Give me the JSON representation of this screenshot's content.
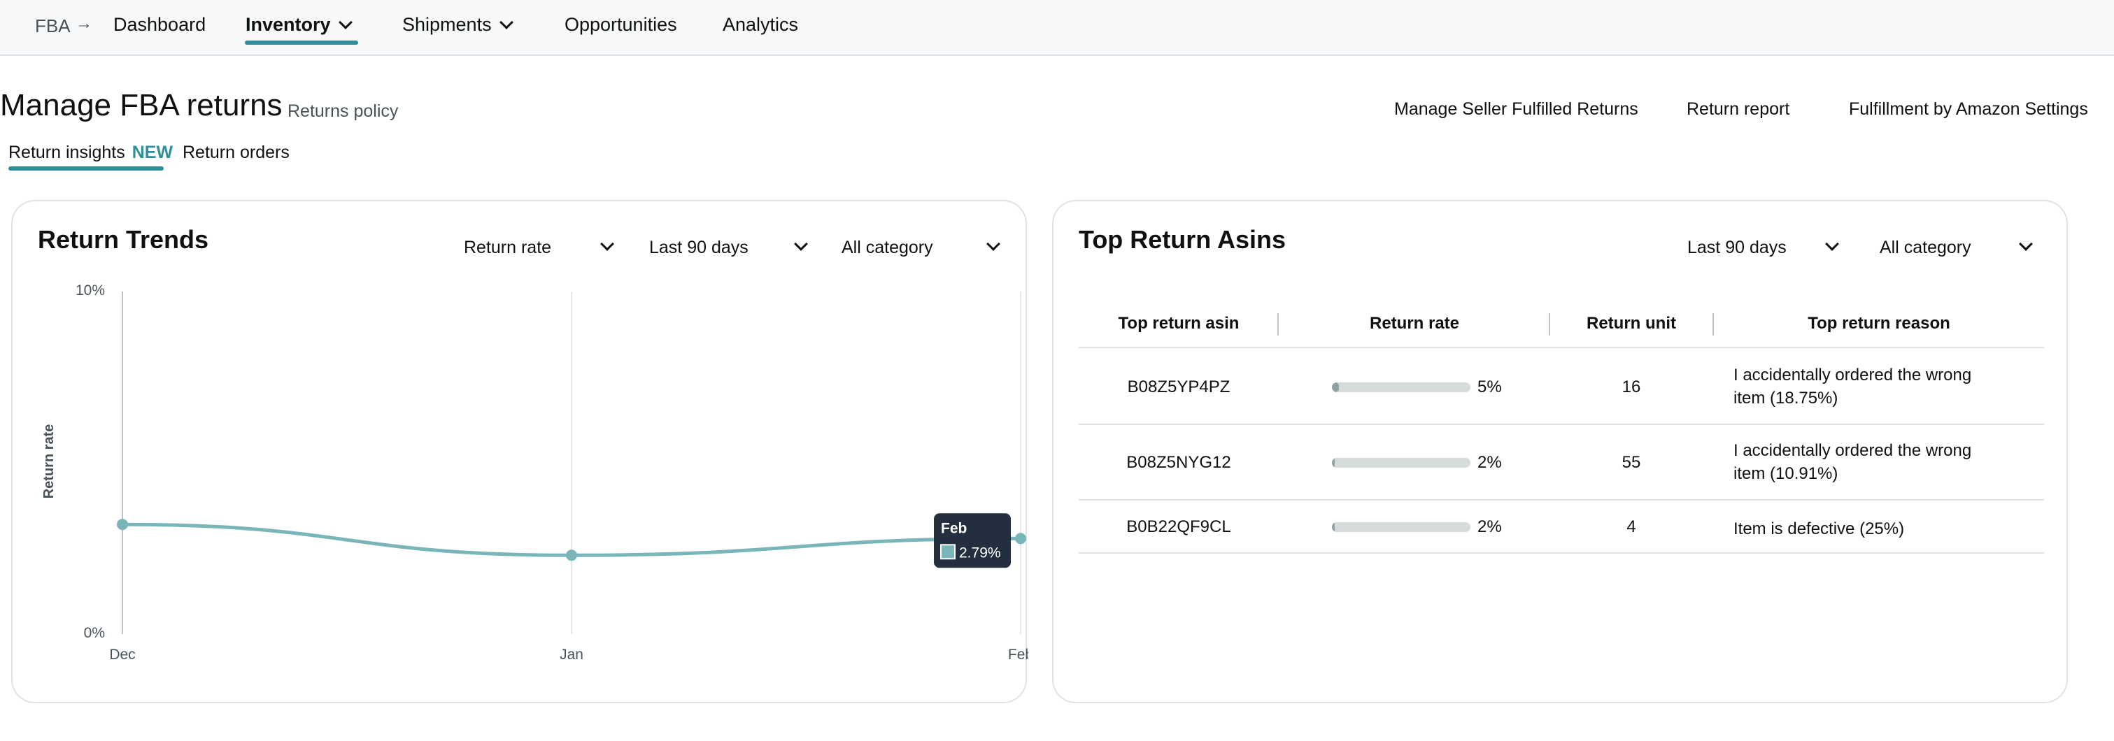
{
  "nav": {
    "breadcrumb": "FBA",
    "items": [
      {
        "label": "Dashboard"
      },
      {
        "label": "Inventory"
      },
      {
        "label": "Shipments"
      },
      {
        "label": "Opportunities"
      },
      {
        "label": "Analytics"
      }
    ]
  },
  "page": {
    "title": "Manage FBA returns",
    "policy_link": "Returns policy",
    "links": [
      "Manage Seller Fulfilled Returns",
      "Return report",
      "Fulfillment by Amazon Settings"
    ],
    "tabs": [
      {
        "label": "Return insights",
        "badge": "NEW"
      },
      {
        "label": "Return orders"
      }
    ]
  },
  "trends": {
    "title": "Return Trends",
    "filters": [
      "Return rate",
      "Last 90 days",
      "All category"
    ],
    "tooltip": {
      "label": "Feb",
      "value": "2.79%"
    }
  },
  "chart_data": {
    "type": "line",
    "categories": [
      "Dec",
      "Jan",
      "Feb"
    ],
    "values": [
      3.2,
      2.3,
      2.79
    ],
    "ylabel": "Return rate",
    "ylim": [
      0,
      10
    ],
    "ytick_labels": [
      "10%",
      "0%"
    ],
    "grid": true,
    "color": "#7ab6b9"
  },
  "asins": {
    "title": "Top Return Asins",
    "filters": [
      "Last 90 days",
      "All category"
    ],
    "columns": [
      "Top return asin",
      "Return rate",
      "Return unit",
      "Top return reason"
    ],
    "rows": [
      {
        "asin": "B08Z5YP4PZ",
        "rate": "5%",
        "rate_value": 5,
        "units": "16",
        "reason": "I accidentally ordered the wrong item (18.75%)"
      },
      {
        "asin": "B08Z5NYG12",
        "rate": "2%",
        "rate_value": 2,
        "units": "55",
        "reason": "I accidentally ordered the wrong item (10.91%)"
      },
      {
        "asin": "B0B22QF9CL",
        "rate": "2%",
        "rate_value": 2,
        "units": "4",
        "reason": "Item is defective (25%)"
      }
    ],
    "bar_max": 100
  },
  "colors": {
    "accent": "#2f8f98",
    "line": "#7ab6b9",
    "tooltip_bg": "#232f3e"
  }
}
